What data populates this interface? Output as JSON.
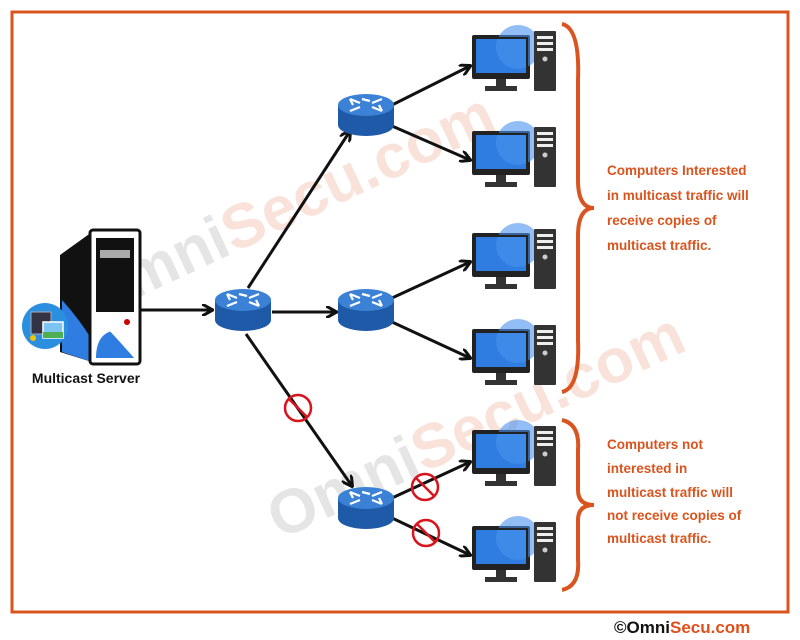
{
  "diagram": {
    "server_label": "Multicast Server",
    "interested_note": [
      "Computers Interested",
      "in multicast traffic will",
      "receive copies of",
      "multicast traffic."
    ],
    "not_interested_note": [
      "Computers not",
      "interested in",
      "multicast traffic will",
      "not receive copies of",
      "multicast traffic."
    ],
    "copyright": {
      "symbol": "©",
      "brand_dark": "Omni",
      "brand_accent": "Secu.com"
    },
    "watermark": "OmniSecu.com",
    "icons": [
      "server-icon",
      "media-icon",
      "router-icon",
      "computer-icon",
      "blocked-icon",
      "brace"
    ],
    "colors": {
      "frame": "#d9541e",
      "router": "#2c6fc4",
      "monitor": "#2f7de0",
      "blocked": "#d8141c",
      "note_text": "#d9541e"
    }
  }
}
